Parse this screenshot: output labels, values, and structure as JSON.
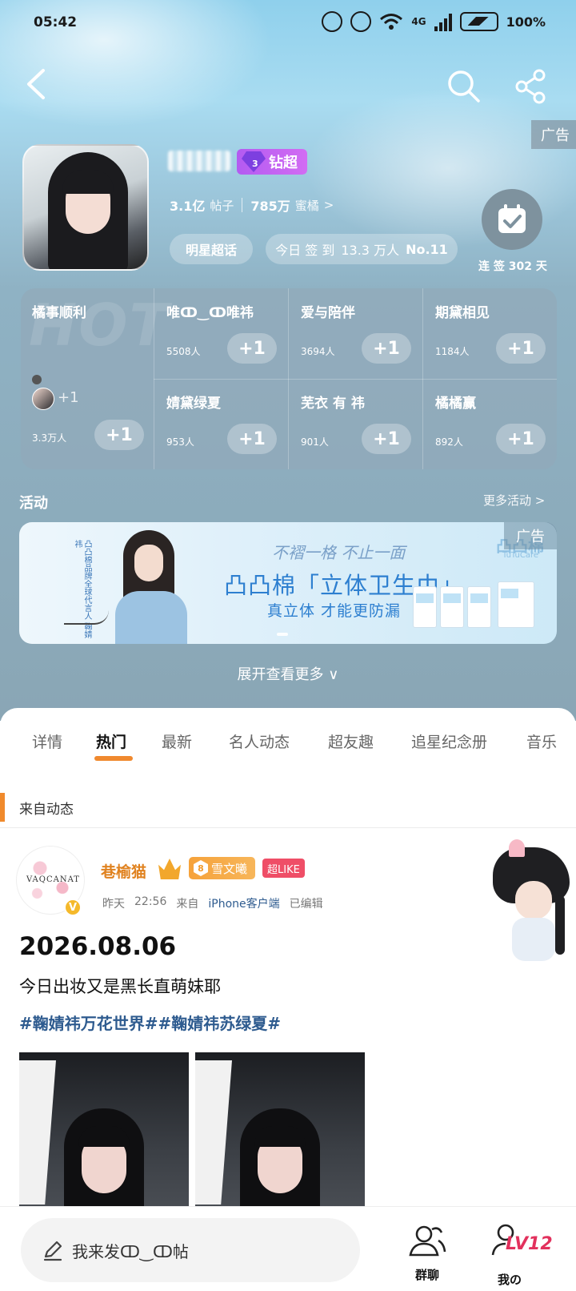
{
  "status_bar": {
    "time": "05:42",
    "network": "4G",
    "battery": "100%"
  },
  "header": {
    "ad_label": "广告",
    "badge_label": "钻超",
    "badge_level": "3"
  },
  "profile": {
    "posts_count": "3.1亿",
    "posts_label": "帖子",
    "fans_count": "785万",
    "fans_label": "蜜橘",
    "fans_chevron": ">",
    "tag_pill": "明星超话",
    "signin_prefix": "今日 签 到",
    "signin_count": "13.3 万人",
    "signin_rank": "No.11",
    "streak_label": "连 签 302 天"
  },
  "hot": {
    "watermark": "HOT",
    "plus_label": "+1",
    "first": {
      "title": "橘事顺利",
      "count": "3.3万人",
      "more": "+1"
    },
    "cells": [
      {
        "title": "唯ↀ‿ↀ唯祎",
        "count": "5508人"
      },
      {
        "title": "爱与陪伴",
        "count": "3694人"
      },
      {
        "title": "期黛相见",
        "count": "1184人"
      },
      {
        "title": "婧黛绿夏",
        "count": "953人"
      },
      {
        "title": "芜衣 有 祎",
        "count": "901人"
      },
      {
        "title": "橘橘赢",
        "count": "892人"
      }
    ]
  },
  "activity": {
    "title": "活动",
    "more": "更多活动 >",
    "ad_label": "广告",
    "banner": {
      "script": "不褶一格 不止一面",
      "headline": "凸凸棉「立体卫生巾」",
      "tagline": "真立体 才能更防漏",
      "brand": "凸凸棉",
      "brand_sub": "TuTuCare",
      "vertical": "凸凸棉品牌全球代言人 鞠婧祎"
    }
  },
  "expand_label": "展开查看更多 ∨",
  "tabs": [
    "详情",
    "热门",
    "最新",
    "名人动态",
    "超友趣",
    "追星纪念册",
    "音乐"
  ],
  "active_tab": "热门",
  "from_label": "来自动态",
  "post": {
    "author": "巷榆猫",
    "fan_badge_level": "8",
    "fan_badge": "雪文曦",
    "like_badge": "超LIKE",
    "verified": "V",
    "avatar_logo": "VAQCANAT",
    "time_day": "昨天",
    "time": "22:56",
    "from_prefix": "来自",
    "device": "iPhone客户端",
    "edited": "已编辑",
    "date": "2026.08.06",
    "text": "今日出妆又是黑长直萌妹耶",
    "tags": "#鞠婧祎万花世界##鞠婧祎苏绿夏#"
  },
  "bottom": {
    "compose": "我来发ↀ‿ↀ帖",
    "group_chat": "群聊",
    "me": "我の",
    "level": "LV12"
  }
}
